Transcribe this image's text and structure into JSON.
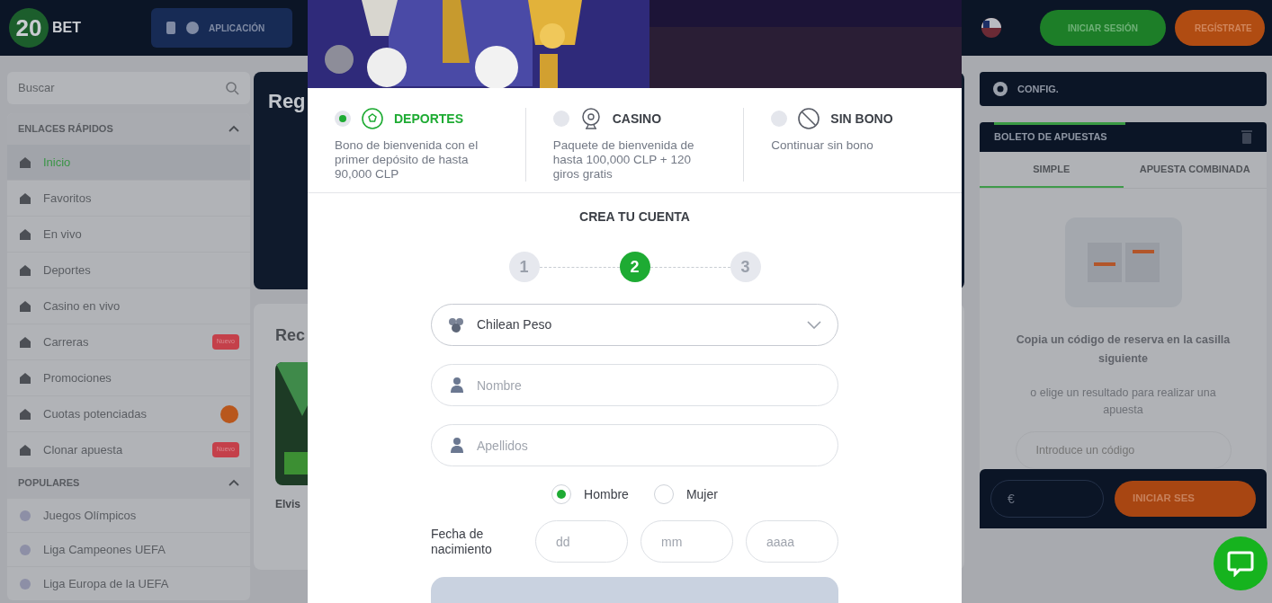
{
  "header": {
    "logo_number": "20",
    "logo_word": "BET",
    "app_button": "APLICACIÓN",
    "login_button": "INICIAR SESIÓN",
    "register_button": "REGÍSTRATE"
  },
  "sidebar": {
    "search": {
      "placeholder": "Buscar"
    },
    "sections": [
      {
        "title": "ENLACES RÁPIDOS",
        "expanded": true,
        "items": [
          {
            "label": "Inicio",
            "selected": true
          },
          {
            "label": "Favoritos",
            "selected": false
          },
          {
            "label": "En vivo",
            "selected": false
          },
          {
            "label": "Deportes",
            "selected": false
          },
          {
            "label": "Casino en vivo",
            "selected": false
          },
          {
            "label": "Carreras",
            "selected": false,
            "badge": "Nuevo"
          },
          {
            "label": "Promociones",
            "selected": false
          },
          {
            "label": "Cuotas potenciadas",
            "selected": false,
            "counter": true
          },
          {
            "label": "Clonar apuesta",
            "selected": false,
            "badge": "Nuevo"
          }
        ]
      },
      {
        "title": "POPULARES",
        "expanded": true,
        "items": [
          {
            "label": "Juegos Olímpicos",
            "selected": false
          },
          {
            "label": "Liga Campeones UEFA",
            "selected": false
          },
          {
            "label": "Liga Europa de la UEFA",
            "selected": false
          }
        ]
      }
    ]
  },
  "middle": {
    "promo_title": "Reg",
    "recent_title": "Rec",
    "game_title": "Elvis"
  },
  "right": {
    "config": "CONFIG.",
    "betslip": {
      "title": "BOLETO DE APUESTAS",
      "tabs": [
        {
          "label": "SIMPLE",
          "selected": true
        },
        {
          "label": "APUESTA COMBINADA",
          "selected": false
        }
      ],
      "hint": "Copia un código de reserva en la casilla siguiente",
      "sub": "o elige un resultado para realizar una apuesta",
      "code": {
        "placeholder": "Introduce un código"
      },
      "currency": "€",
      "login_button": "INICIAR SES"
    }
  },
  "modal": {
    "bonuses": [
      {
        "title": "DEPORTES",
        "description": "Bono de bienvenida con el primer depósito de hasta 90,000 CLP",
        "selected": true
      },
      {
        "title": "CASINO",
        "description": "Paquete de bienvenida de hasta 100,000 CLP + 120 giros gratis",
        "selected": false
      },
      {
        "title": "SIN BONO",
        "description": "Continuar sin bono",
        "selected": false
      }
    ],
    "heading": "CREA TU CUENTA",
    "steps": [
      {
        "label": "1",
        "selected": false
      },
      {
        "label": "2",
        "selected": true
      },
      {
        "label": "3",
        "selected": false
      }
    ],
    "currency": {
      "value": "Chilean Peso"
    },
    "fields": [
      {
        "placeholder": "Nombre"
      },
      {
        "placeholder": "Apellidos"
      }
    ],
    "gender": [
      {
        "label": "Hombre",
        "selected": true
      },
      {
        "label": "Mujer",
        "selected": false
      }
    ],
    "birth": {
      "label": "Fecha de nacimiento",
      "fields": [
        {
          "placeholder": "dd"
        },
        {
          "placeholder": "mm"
        },
        {
          "placeholder": "aaaa"
        }
      ]
    }
  }
}
